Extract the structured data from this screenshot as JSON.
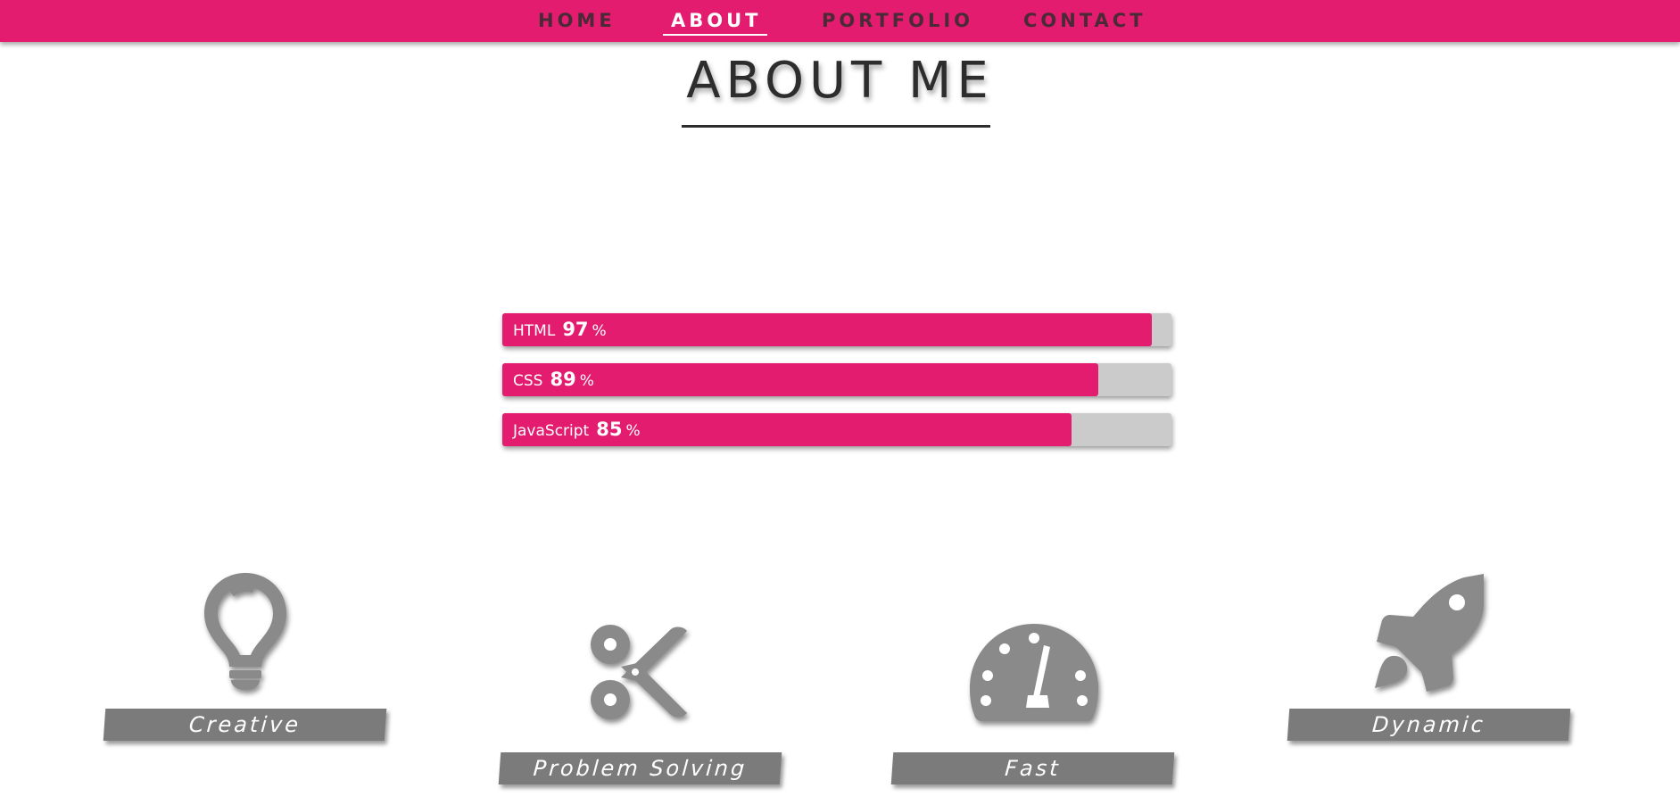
{
  "nav": {
    "items": [
      {
        "label": "HOME"
      },
      {
        "label": "ABOUT"
      },
      {
        "label": "PORTFOLIO"
      },
      {
        "label": "CONTACT"
      }
    ],
    "active_index": 1
  },
  "about": {
    "title": "ABOUT ME"
  },
  "skills": [
    {
      "name": "HTML",
      "percent": "97",
      "unit": "%",
      "level": 0.97
    },
    {
      "name": "CSS",
      "percent": "89",
      "unit": "%",
      "level": 0.89
    },
    {
      "name": "JavaScript",
      "percent": "85",
      "unit": "%",
      "level": 0.85
    }
  ],
  "features": [
    {
      "label": "Creative",
      "icon": "lightbulb-icon"
    },
    {
      "label": "Problem Solving",
      "icon": "scissors-icon"
    },
    {
      "label": "Fast",
      "icon": "speedometer-icon"
    },
    {
      "label": "Dynamic",
      "icon": "rocket-icon"
    }
  ],
  "colors": {
    "brand": "#e31c6f",
    "track": "#cbcbcb",
    "icon": "#8a8a8a",
    "label_bg": "#7b7b7b",
    "title": "#2d2d2d"
  }
}
